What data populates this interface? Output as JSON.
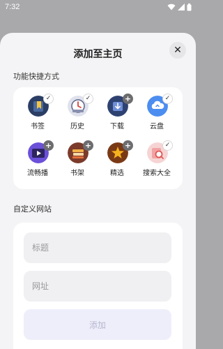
{
  "status_bar": {
    "time": "7:32"
  },
  "sheet": {
    "title": "添加至主页",
    "close_label": "✕"
  },
  "shortcuts": {
    "section_label": "功能快捷方式",
    "items": [
      {
        "label": "书签",
        "icon": "bookmark-icon",
        "state": "added",
        "badge": "✓",
        "color": "#2b3e64"
      },
      {
        "label": "历史",
        "icon": "clock-icon",
        "state": "added",
        "badge": "✓",
        "color": "#dfe1ec"
      },
      {
        "label": "下载",
        "icon": "download-icon",
        "state": "add",
        "badge": "+",
        "color": "#2e4271"
      },
      {
        "label": "云盘",
        "icon": "cloud-icon",
        "state": "added",
        "badge": "✓",
        "color": "#4c8df0"
      },
      {
        "label": "流畅播",
        "icon": "play-icon",
        "state": "add",
        "badge": "+",
        "color": "#6b50d9"
      },
      {
        "label": "书架",
        "icon": "bookshelf-icon",
        "state": "add",
        "badge": "+",
        "color": "#7b3a2a"
      },
      {
        "label": "精选",
        "icon": "star-icon",
        "state": "add",
        "badge": "+",
        "color": "#7a3915"
      },
      {
        "label": "搜索大全",
        "icon": "search-icon",
        "state": "added",
        "badge": "✓",
        "color": "#f6d4d4"
      }
    ]
  },
  "custom_site": {
    "section_label": "自定义网站",
    "title_placeholder": "标题",
    "url_placeholder": "网址",
    "add_label": "添加"
  }
}
